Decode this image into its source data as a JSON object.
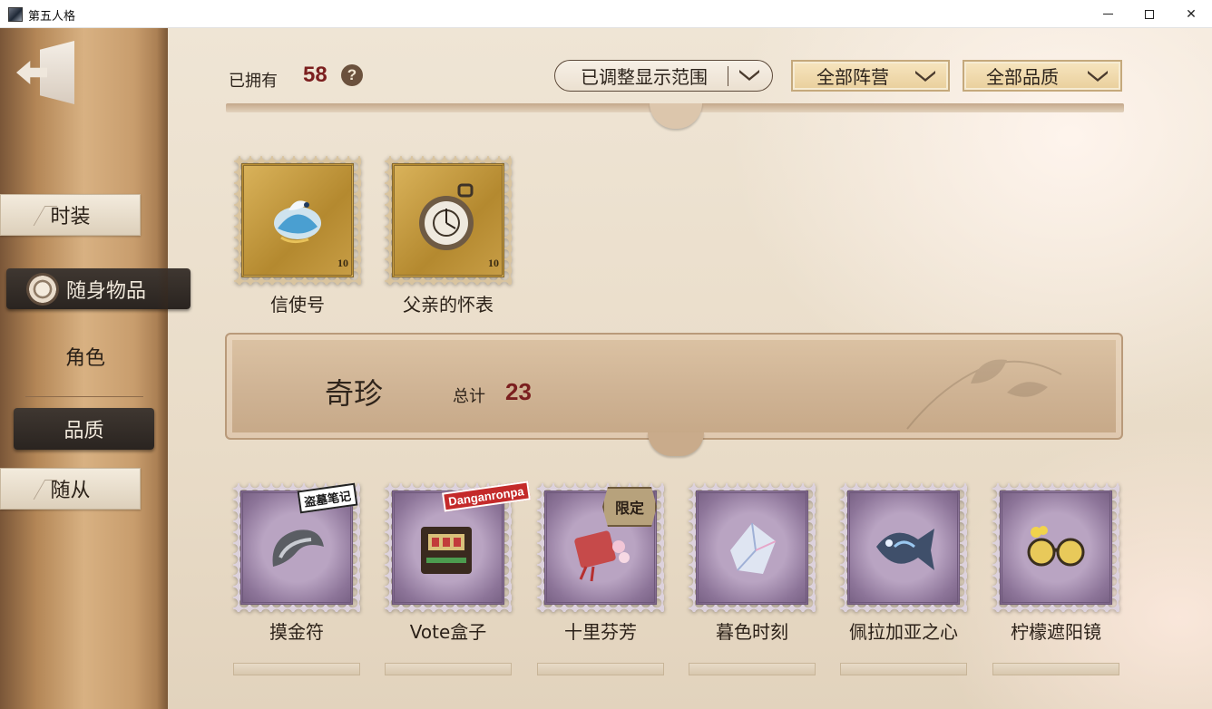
{
  "window": {
    "title": "第五人格",
    "minimize_icon": "minimize-icon",
    "maximize_icon": "maximize-icon",
    "close_label": "✕"
  },
  "sidebar": {
    "exit_icon": "exit-door-icon",
    "items": [
      {
        "label": "时装",
        "active": false
      },
      {
        "label": "随身物品",
        "active": true
      },
      {
        "label": "角色",
        "active": false
      },
      {
        "label": "品质",
        "active": true
      },
      {
        "label": "随从",
        "active": false
      }
    ]
  },
  "header": {
    "owned_label": "已拥有",
    "owned_count": "58",
    "help_label": "?",
    "filters": {
      "scope": "已调整显示范围",
      "camp": "全部阵营",
      "quality": "全部品质"
    }
  },
  "sections": {
    "top_items": [
      {
        "name": "信使号",
        "price": "10"
      },
      {
        "name": "父亲的怀表",
        "price": "10"
      }
    ],
    "rare": {
      "title": "奇珍",
      "total_label": "总计",
      "total_count": "23",
      "items": [
        {
          "name": "摸金符",
          "badge": "盗墓笔记"
        },
        {
          "name": "Vote盒子",
          "badge": "Danganronpa"
        },
        {
          "name": "十里芬芳",
          "badge": "限定"
        },
        {
          "name": "暮色时刻",
          "badge": ""
        },
        {
          "name": "佩拉加亚之心",
          "badge": ""
        },
        {
          "name": "柠檬遮阳镜",
          "badge": ""
        }
      ]
    }
  },
  "colors": {
    "count_red": "#7b1f1f",
    "rail_brown": "#b48757",
    "paper": "#efe5d5",
    "stamp_gold": "#b4892f",
    "stamp_purple": "#8d7599"
  }
}
